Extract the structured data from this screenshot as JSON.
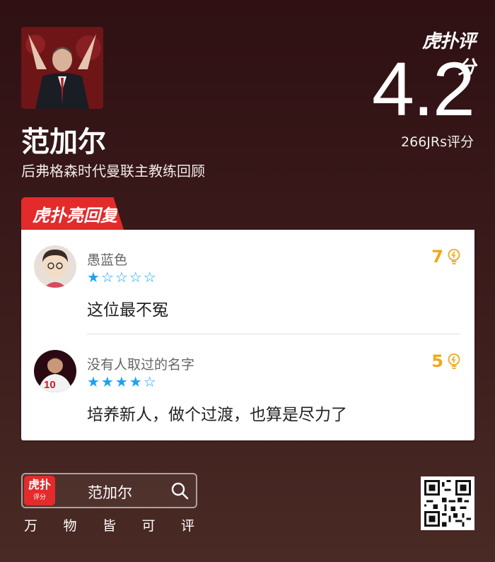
{
  "brand": {
    "logo_text": "虎扑评分",
    "reply_tab": "虎扑亮回复"
  },
  "subject": {
    "name": "范加尔",
    "subtitle": "后弗格森时代曼联主教练回顾"
  },
  "rating": {
    "score": "4.2",
    "count_text": "266JRs评分"
  },
  "comments": [
    {
      "user": "愚蓝色",
      "stars": 1,
      "max_stars": 5,
      "text": "这位最不冤",
      "likes": "7"
    },
    {
      "user": "没有人取过的名字",
      "stars": 4,
      "max_stars": 5,
      "text": "培养新人，做个过渡，也算是尽力了",
      "likes": "5"
    }
  ],
  "footer": {
    "search_logo": "虎扑",
    "search_logo_sub": "评分",
    "search_text": "范加尔",
    "motto": [
      "万",
      "物",
      "皆",
      "可",
      "评"
    ]
  },
  "colors": {
    "accent": "#e32b2b",
    "star": "#1aa3f0",
    "likes": "#f0a81a"
  },
  "icons": {
    "search": "magnifier-icon",
    "like": "lightbulb-icon",
    "qr": "qr-code-icon"
  }
}
